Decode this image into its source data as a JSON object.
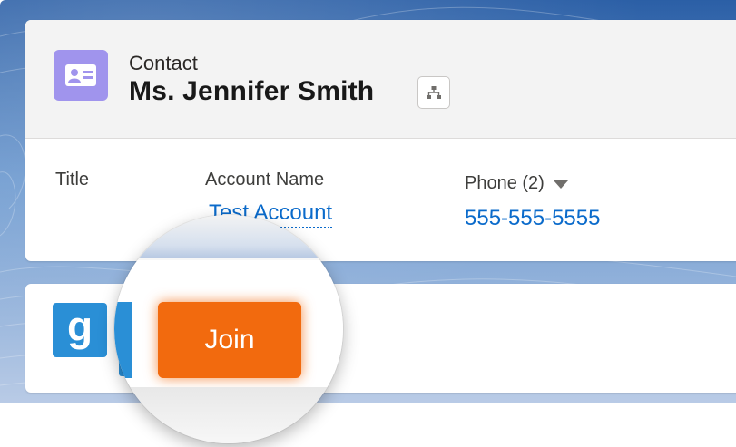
{
  "record": {
    "object_label": "Contact",
    "name": "Ms. Jennifer Smith",
    "icon": "contact-card-icon",
    "hierarchy_icon": "hierarchy-icon"
  },
  "fields": {
    "title_label": "Title",
    "account_label": "Account Name",
    "account_value": "Test Account",
    "phone_label": "Phone (2)",
    "phone_value": "555-555-5555"
  },
  "app": {
    "icon_letter": "g",
    "join_label": "Join"
  },
  "colors": {
    "accent_orange": "#f26a0e",
    "link_blue": "#0b6bcb",
    "icon_purple": "#a094ed",
    "app_blue": "#2a8fd6"
  }
}
